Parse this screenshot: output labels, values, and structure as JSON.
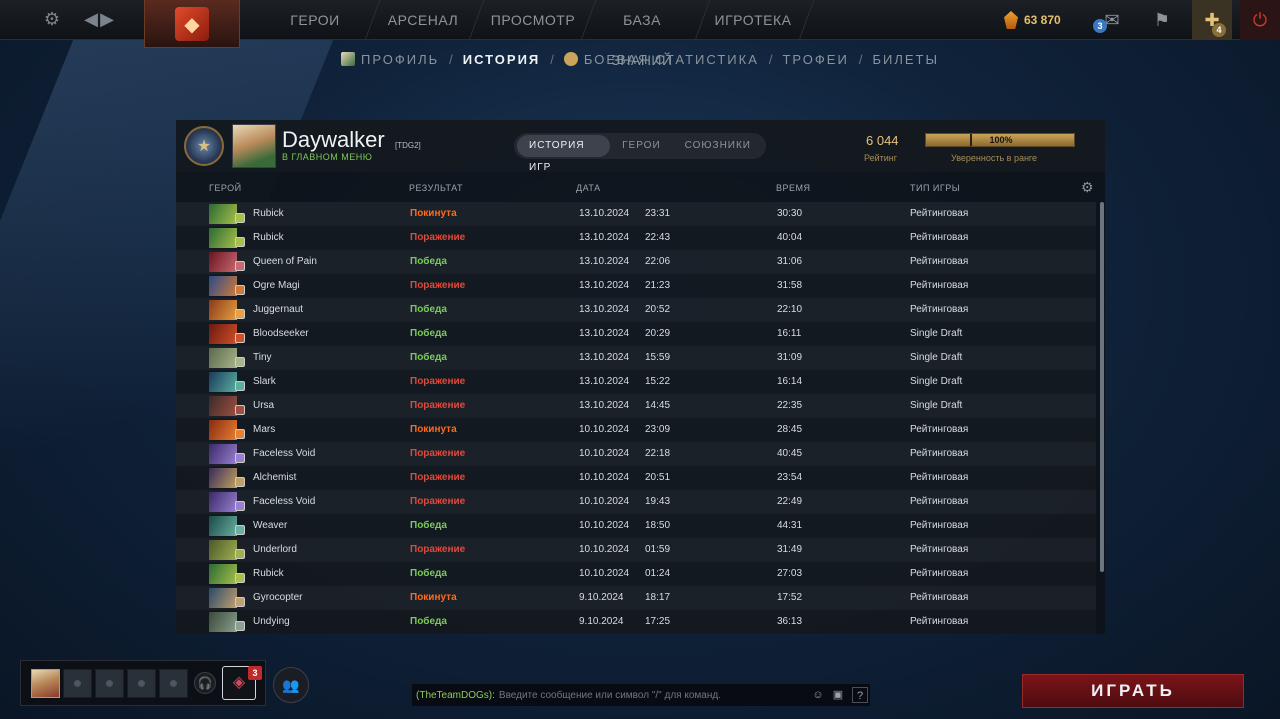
{
  "topbar": {
    "settings_icon": "gear-icon",
    "nav": [
      "ГЕРОИ",
      "АРСЕНАЛ",
      "ПРОСМОТР",
      "БАЗА ЗНАНИЙ",
      "ИГРОТЕКА"
    ],
    "shards": "63 870",
    "chat_badge": "3",
    "plus_badge": "4"
  },
  "subnav": {
    "profile": "ПРОФИЛЬ",
    "history": "ИСТОРИЯ",
    "stats": "БОЕВАЯ СТАТИСТИКА",
    "trophies": "ТРОФЕИ",
    "tickets": "БИЛЕТЫ",
    "sep": "/"
  },
  "player": {
    "name": "Daywalker",
    "tag": "[TDG2]",
    "status": "В ГЛАВНОМ МЕНЮ"
  },
  "tabs": [
    "ИСТОРИЯ ИГР",
    "ГЕРОИ",
    "СОЮЗНИКИ"
  ],
  "rating": {
    "value": "6 044",
    "label": "Рейтинг",
    "confidence_text": "100%",
    "confidence_fraction": 1.0,
    "confidence_label": "Уверенность в ранге"
  },
  "columns": {
    "hero": "ГЕРОЙ",
    "result": "РЕЗУЛЬТАТ",
    "date": "ДАТА",
    "duration": "ВРЕМЯ",
    "mode": "ТИП ИГРЫ"
  },
  "colors": {
    "win": "#7cc95a",
    "loss": "#e0493a",
    "abandon": "#ff6a1a"
  },
  "matches": [
    {
      "hero": "Rubick",
      "result": "Покинута",
      "kind": "abandon",
      "date": "13.10.2024",
      "time": "23:31",
      "duration": "30:30",
      "mode": "Рейтинговая",
      "c1": "#2c6a34",
      "c2": "#a6c04a"
    },
    {
      "hero": "Rubick",
      "result": "Поражение",
      "kind": "loss",
      "date": "13.10.2024",
      "time": "22:43",
      "duration": "40:04",
      "mode": "Рейтинговая",
      "c1": "#2c6a34",
      "c2": "#a6c04a"
    },
    {
      "hero": "Queen of Pain",
      "result": "Победа",
      "kind": "win",
      "date": "13.10.2024",
      "time": "22:06",
      "duration": "31:06",
      "mode": "Рейтинговая",
      "c1": "#6a1420",
      "c2": "#c86a70"
    },
    {
      "hero": "Ogre Magi",
      "result": "Поражение",
      "kind": "loss",
      "date": "13.10.2024",
      "time": "21:23",
      "duration": "31:58",
      "mode": "Рейтинговая",
      "c1": "#2a4a8a",
      "c2": "#d07a3a"
    },
    {
      "hero": "Juggernaut",
      "result": "Победа",
      "kind": "win",
      "date": "13.10.2024",
      "time": "20:52",
      "duration": "22:10",
      "mode": "Рейтинговая",
      "c1": "#8a3a1a",
      "c2": "#e8a040"
    },
    {
      "hero": "Bloodseeker",
      "result": "Победа",
      "kind": "win",
      "date": "13.10.2024",
      "time": "20:29",
      "duration": "16:11",
      "mode": "Single Draft",
      "c1": "#6a1a10",
      "c2": "#d0502a"
    },
    {
      "hero": "Tiny",
      "result": "Победа",
      "kind": "win",
      "date": "13.10.2024",
      "time": "15:59",
      "duration": "31:09",
      "mode": "Single Draft",
      "c1": "#5a6a4a",
      "c2": "#a8b48a"
    },
    {
      "hero": "Slark",
      "result": "Поражение",
      "kind": "loss",
      "date": "13.10.2024",
      "time": "15:22",
      "duration": "16:14",
      "mode": "Single Draft",
      "c1": "#1a3a5a",
      "c2": "#5ab0a0"
    },
    {
      "hero": "Ursa",
      "result": "Поражение",
      "kind": "loss",
      "date": "13.10.2024",
      "time": "14:45",
      "duration": "22:35",
      "mode": "Single Draft",
      "c1": "#3a2a2a",
      "c2": "#a05040"
    },
    {
      "hero": "Mars",
      "result": "Покинута",
      "kind": "abandon",
      "date": "10.10.2024",
      "time": "23:09",
      "duration": "28:45",
      "mode": "Рейтинговая",
      "c1": "#8a2a10",
      "c2": "#e88030"
    },
    {
      "hero": "Faceless Void",
      "result": "Поражение",
      "kind": "loss",
      "date": "10.10.2024",
      "time": "22:18",
      "duration": "40:45",
      "mode": "Рейтинговая",
      "c1": "#3a2a6a",
      "c2": "#9a80d0"
    },
    {
      "hero": "Alchemist",
      "result": "Поражение",
      "kind": "loss",
      "date": "10.10.2024",
      "time": "20:51",
      "duration": "23:54",
      "mode": "Рейтинговая",
      "c1": "#3a2a5a",
      "c2": "#c0a060"
    },
    {
      "hero": "Faceless Void",
      "result": "Поражение",
      "kind": "loss",
      "date": "10.10.2024",
      "time": "19:43",
      "duration": "22:49",
      "mode": "Рейтинговая",
      "c1": "#3a2a6a",
      "c2": "#9a80d0"
    },
    {
      "hero": "Weaver",
      "result": "Победа",
      "kind": "win",
      "date": "10.10.2024",
      "time": "18:50",
      "duration": "44:31",
      "mode": "Рейтинговая",
      "c1": "#1a4a4a",
      "c2": "#6ab0a0"
    },
    {
      "hero": "Underlord",
      "result": "Поражение",
      "kind": "loss",
      "date": "10.10.2024",
      "time": "01:59",
      "duration": "31:49",
      "mode": "Рейтинговая",
      "c1": "#4a5a2a",
      "c2": "#a0b050"
    },
    {
      "hero": "Rubick",
      "result": "Победа",
      "kind": "win",
      "date": "10.10.2024",
      "time": "01:24",
      "duration": "27:03",
      "mode": "Рейтинговая",
      "c1": "#2c6a34",
      "c2": "#a6c04a"
    },
    {
      "hero": "Gyrocopter",
      "result": "Покинута",
      "kind": "abandon",
      "date": "9.10.2024",
      "time": "18:17",
      "duration": "17:52",
      "mode": "Рейтинговая",
      "c1": "#2a4a6a",
      "c2": "#c0a070"
    },
    {
      "hero": "Undying",
      "result": "Победа",
      "kind": "win",
      "date": "9.10.2024",
      "time": "17:25",
      "duration": "36:13",
      "mode": "Рейтинговая",
      "c1": "#3a4a3a",
      "c2": "#8aa090"
    }
  ],
  "bottom": {
    "inventory_badge": "3",
    "chat_channel": "(TheTeamDOGs):",
    "chat_placeholder": "Введите сообщение или символ \"/\" для команд.",
    "help": "?",
    "play": "ИГРАТЬ"
  }
}
